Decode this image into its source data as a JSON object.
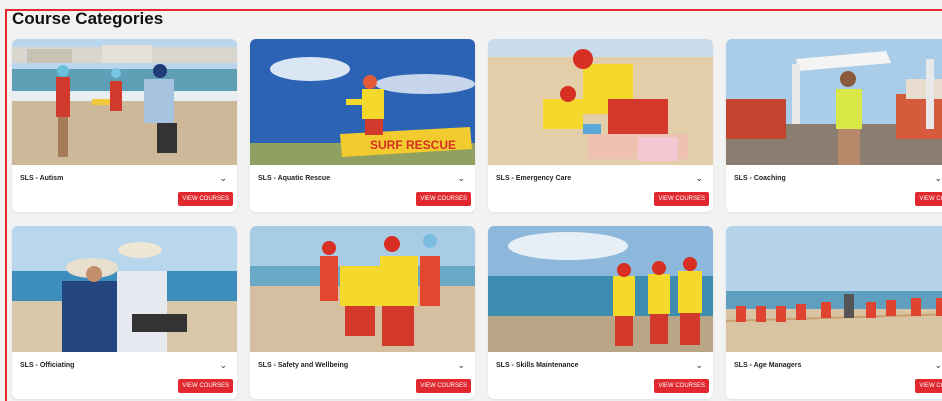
{
  "page": {
    "title": "Course Categories"
  },
  "button_label": "VIEW COURSES",
  "colors": {
    "accent": "#e0282e"
  },
  "icons": {
    "expand": "chevron-down-icon"
  },
  "categories": [
    {
      "title": "SLS - Autism"
    },
    {
      "title": "SLS - Aquatic Rescue"
    },
    {
      "title": "SLS - Emergency Care"
    },
    {
      "title": "SLS - Coaching"
    },
    {
      "title": "SLS - Officiating"
    },
    {
      "title": "SLS - Safety and Wellbeing"
    },
    {
      "title": "SLS - Skills Maintenance"
    },
    {
      "title": "SLS - Age Managers"
    }
  ]
}
